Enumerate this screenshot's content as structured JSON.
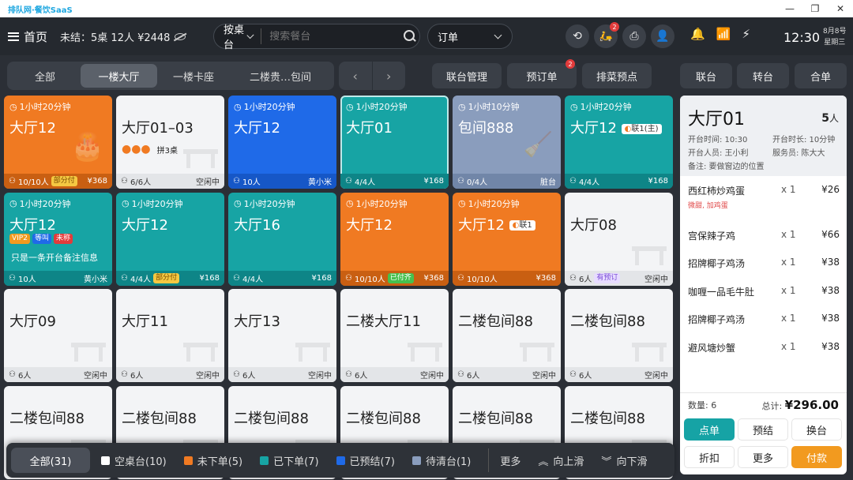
{
  "app": {
    "title": "排队网·餐饮SaaS"
  },
  "topbar": {
    "home_label": "首页",
    "unsettled": "未结：5桌 12人 ¥2448",
    "table_filter": "按桌台",
    "search_placeholder": "搜索餐台",
    "order_filter": "订单",
    "delivery_badge": "2",
    "clock": "12:30",
    "date_line1": "8月8号",
    "date_line2": "星期三"
  },
  "area_tabs": [
    "全部",
    "一楼大厅",
    "一楼卡座",
    "二楼贵…包间"
  ],
  "actions": {
    "joint_mgmt": "联台管理",
    "reservations": "预订单",
    "reservations_badge": "2",
    "queue": "排菜预点",
    "join_table": "联台",
    "transfer": "转台",
    "merge": "合单"
  },
  "tables": [
    {
      "style": "orange",
      "timer": "1小时20分钟",
      "name": "大厅12",
      "guests": "10/10人",
      "tag": "部分付",
      "tag_type": "partial",
      "amount": "¥368",
      "icon": "cake"
    },
    {
      "style": "empty",
      "name": "大厅01–03",
      "guests": "6/6人",
      "status": "空闲中",
      "merge_text": "拼3桌"
    },
    {
      "style": "blue",
      "timer": "1小时20分钟",
      "name": "大厅12",
      "guests": "10人",
      "waiter": "黄小米"
    },
    {
      "style": "teal",
      "timer": "1小时20分钟",
      "name": "大厅01",
      "guests": "4/4人",
      "amount": "¥168",
      "selected": true
    },
    {
      "style": "gray",
      "timer": "1小时10分钟",
      "name": "包间888",
      "guests": "0/4人",
      "status": "脏台",
      "icon": "broom"
    },
    {
      "style": "teal",
      "timer": "1小时20分钟",
      "name": "大厅12",
      "guests": "4/4人",
      "amount": "¥168",
      "link": "联1(主)"
    },
    {
      "style": "teal",
      "timer": "1小时20分钟",
      "name": "大厅12",
      "guests": "10人",
      "waiter": "黄小米",
      "tags": [
        "VIP2",
        "等叫",
        "未称"
      ],
      "note": "只是一条开台备注信息"
    },
    {
      "style": "teal",
      "timer": "1小时20分钟",
      "name": "大厅12",
      "guests": "4/4人",
      "tag": "部分付",
      "tag_type": "partial",
      "amount": "¥168"
    },
    {
      "style": "teal",
      "timer": "1小时20分钟",
      "name": "大厅16",
      "guests": "4/4人",
      "amount": "¥168"
    },
    {
      "style": "orange",
      "timer": "1小时20分钟",
      "name": "大厅12",
      "guests": "10/10人",
      "tag": "已付齐",
      "tag_type": "paid",
      "amount": "¥368"
    },
    {
      "style": "orange",
      "timer": "1小时20分钟",
      "name": "大厅12",
      "guests": "10/10人",
      "amount": "¥368",
      "link": "联1"
    },
    {
      "style": "empty",
      "name": "大厅08",
      "guests": "6人",
      "tag": "有预订",
      "tag_type": "reserved",
      "status": "空闲中"
    },
    {
      "style": "empty",
      "name": "大厅09",
      "guests": "6人",
      "status": "空闲中"
    },
    {
      "style": "empty",
      "name": "大厅11",
      "guests": "6人",
      "status": "空闲中"
    },
    {
      "style": "empty",
      "name": "大厅13",
      "guests": "6人",
      "status": "空闲中"
    },
    {
      "style": "empty",
      "name": "二楼大厅11",
      "guests": "6人",
      "status": "空闲中"
    },
    {
      "style": "empty",
      "name": "二楼包间88",
      "guests": "6人",
      "status": "空闲中"
    },
    {
      "style": "empty",
      "name": "二楼包间88",
      "guests": "6人",
      "status": "空闲中"
    },
    {
      "style": "empty",
      "name": "二楼包间88"
    },
    {
      "style": "empty",
      "name": "二楼包间88"
    },
    {
      "style": "empty",
      "name": "二楼包间88"
    },
    {
      "style": "empty",
      "name": "二楼包间88"
    },
    {
      "style": "empty",
      "name": "二楼包间88"
    },
    {
      "style": "empty",
      "name": "二楼包间88"
    }
  ],
  "statusbar": {
    "all": "全部(31)",
    "items": [
      {
        "label": "空桌台(10)",
        "color": "#ffffff"
      },
      {
        "label": "未下单(5)",
        "color": "#f07a22"
      },
      {
        "label": "已下单(7)",
        "color": "#17a4a4"
      },
      {
        "label": "已预结(7)",
        "color": "#1f6ae8"
      },
      {
        "label": "待清台(1)",
        "color": "#8a9dbd"
      }
    ],
    "more": "更多",
    "up": "向上滑",
    "down": "向下滑"
  },
  "panel": {
    "table_name": "大厅01",
    "guests_num": "5",
    "guests_unit": "人",
    "open_time": "开台时间: 10:30",
    "duration": "开台时长: 10分钟",
    "opener": "开台人员: 王小利",
    "server": "服务员: 陈大大",
    "note": "备注: 要做窗边的位置",
    "items": [
      {
        "name": "西红柿炒鸡蛋",
        "qty": "x 1",
        "price": "¥26",
        "note": "微甜, 加鸡蛋"
      },
      {
        "name": "宫保辣子鸡",
        "qty": "x 1",
        "price": "¥66"
      },
      {
        "name": "招牌椰子鸡汤",
        "qty": "x 1",
        "price": "¥38"
      },
      {
        "name": "咖喱一品毛牛肚",
        "qty": "x 1",
        "price": "¥38"
      },
      {
        "name": "招牌椰子鸡汤",
        "qty": "x 1",
        "price": "¥38"
      },
      {
        "name": "避风塘炒蟹",
        "qty": "x 1",
        "price": "¥38"
      }
    ],
    "count": "数量: 6",
    "total_label": "总计:",
    "total": "¥296.00",
    "buttons": {
      "order": "点单",
      "presettle": "预结",
      "change": "换台",
      "discount": "折扣",
      "more": "更多",
      "pay": "付款"
    }
  },
  "colors": {
    "orange": "#f07a22",
    "teal": "#17a4a4",
    "blue": "#1f6ae8",
    "gray": "#8a9dbd",
    "pay": "#f29a1f"
  }
}
